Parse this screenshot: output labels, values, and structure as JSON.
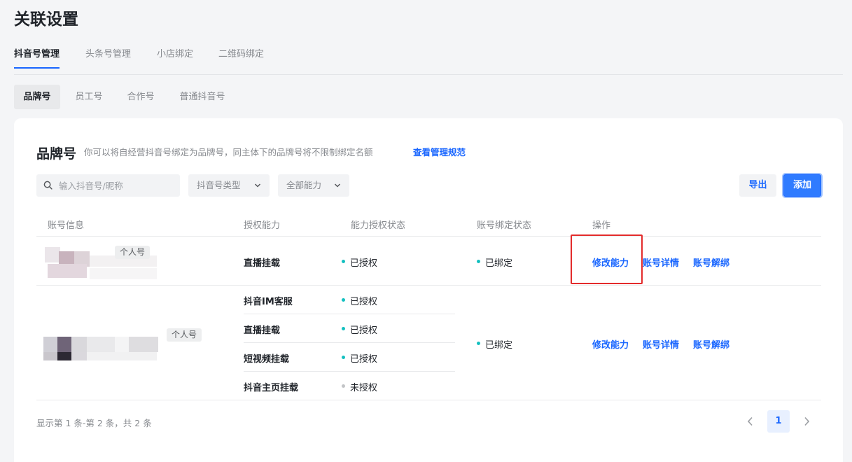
{
  "page": {
    "title": "关联设置"
  },
  "main_tabs": [
    {
      "label": "抖音号管理",
      "active": true
    },
    {
      "label": "头条号管理",
      "active": false
    },
    {
      "label": "小店绑定",
      "active": false
    },
    {
      "label": "二维码绑定",
      "active": false
    }
  ],
  "sub_tabs": [
    {
      "label": "品牌号",
      "active": true
    },
    {
      "label": "员工号",
      "active": false
    },
    {
      "label": "合作号",
      "active": false
    },
    {
      "label": "普通抖音号",
      "active": false
    }
  ],
  "section": {
    "title": "品牌号",
    "description": "你可以将自经营抖音号绑定为品牌号，同主体下的品牌号将不限制绑定名额",
    "link": "查看管理规范"
  },
  "filters": {
    "search_placeholder": "输入抖音号/昵称",
    "type_select": "抖音号类型",
    "ability_select": "全部能力"
  },
  "buttons": {
    "export": "导出",
    "add": "添加"
  },
  "table": {
    "headers": [
      "账号信息",
      "授权能力",
      "能力授权状态",
      "账号绑定状态",
      "操作"
    ],
    "rows": [
      {
        "tag": "个人号",
        "abilities": [
          {
            "name": "直播挂载",
            "status": "已授权",
            "status_color": "#14c0c0"
          }
        ],
        "bind_status": "已绑定",
        "bind_color": "#14c0c0",
        "actions": [
          "修改能力",
          "账号详情",
          "账号解绑"
        ]
      },
      {
        "tag": "个人号",
        "abilities": [
          {
            "name": "抖音IM客服",
            "status": "已授权",
            "status_color": "#14c0c0"
          },
          {
            "name": "直播挂载",
            "status": "已授权",
            "status_color": "#14c0c0"
          },
          {
            "name": "短视频挂载",
            "status": "已授权",
            "status_color": "#14c0c0"
          },
          {
            "name": "抖音主页挂载",
            "status": "未授权",
            "status_color": "#c2c4c7"
          }
        ],
        "bind_status": "已绑定",
        "bind_color": "#14c0c0",
        "actions": [
          "修改能力",
          "账号详情",
          "账号解绑"
        ]
      }
    ]
  },
  "pagination": {
    "summary": "显示第 1 条-第 2 条，共 2 条",
    "current": "1",
    "prev": "‹",
    "next": "›"
  },
  "colors": {
    "accent": "#1966ff",
    "highlight": "#e32b2b"
  }
}
